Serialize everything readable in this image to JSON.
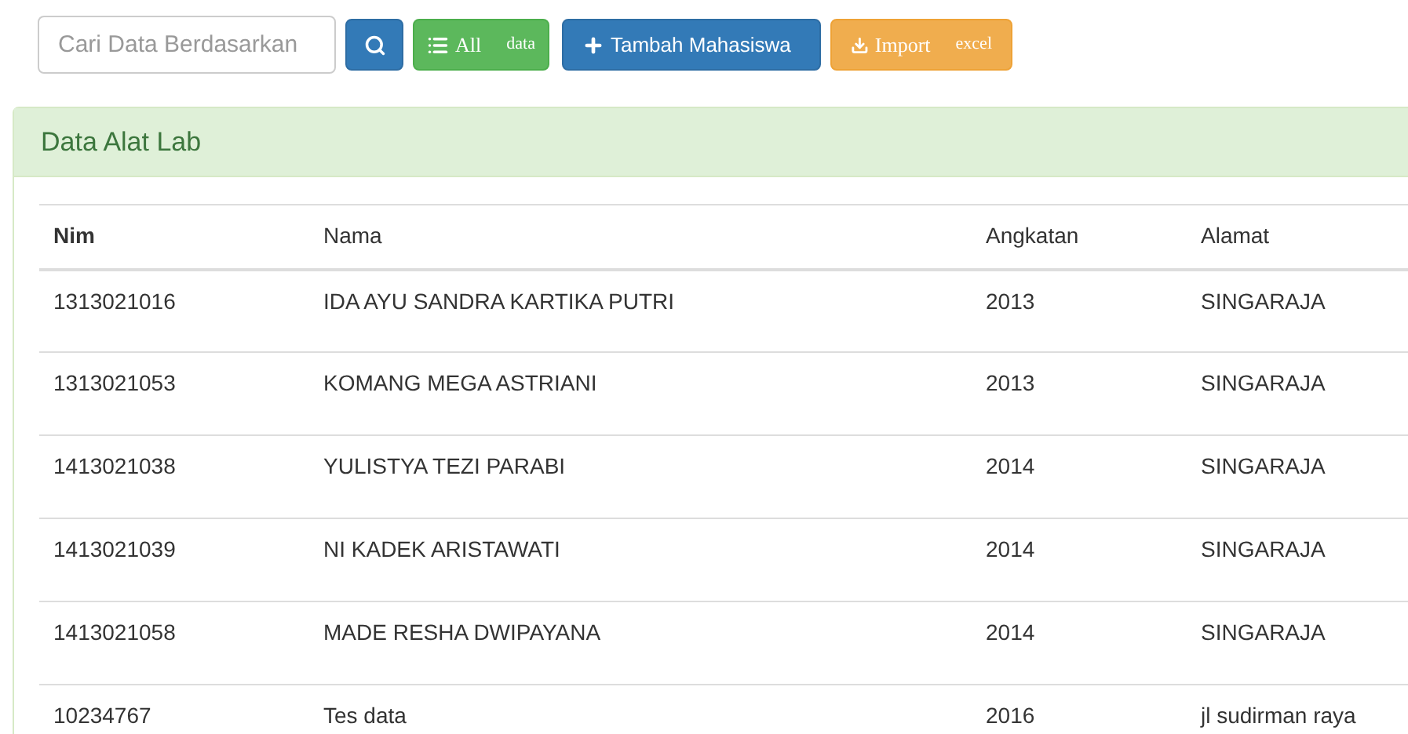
{
  "toolbar": {
    "search": {
      "placeholder": "Cari Data Berdasarkan"
    },
    "buttons": [
      {
        "kind": "search"
      },
      {
        "kind": "list",
        "label": "All",
        "label_2": "data"
      },
      {
        "kind": "add",
        "label": "Tambah Mahasiswa"
      },
      {
        "kind": "import",
        "label": "Import",
        "label_2": "excel"
      }
    ]
  },
  "panel": {
    "title": "Data Alat Lab"
  },
  "table": {
    "columns": [
      "Nim",
      "Nama",
      "Angkatan",
      "Alamat"
    ],
    "rows": [
      [
        "1313021016",
        "IDA AYU SANDRA KARTIKA PUTRI",
        "2013",
        "SINGARAJA"
      ],
      [
        "1313021053",
        "KOMANG MEGA ASTRIANI",
        "2013",
        "SINGARAJA"
      ],
      [
        "1413021038",
        "YULISTYA TEZI PARABI",
        "2014",
        "SINGARAJA"
      ],
      [
        "1413021039",
        "NI KADEK ARISTAWATI",
        "2014",
        "SINGARAJA"
      ],
      [
        "1413021058",
        "MADE RESHA DWIPAYANA",
        "2014",
        "SINGARAJA"
      ],
      [
        "10234767",
        "Tes data",
        "2016",
        "jl sudirman raya"
      ]
    ]
  }
}
